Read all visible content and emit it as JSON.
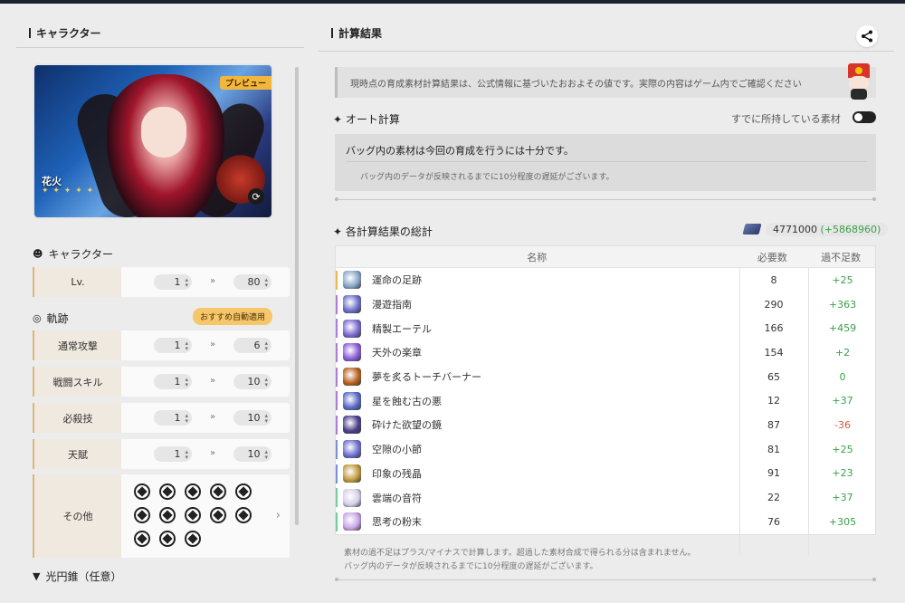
{
  "left": {
    "title": "キャラクター",
    "character": {
      "preview_badge": "プレビュー",
      "name": "花火",
      "stars": "✦ ✦ ✦ ✦ ✦"
    },
    "character_section": "キャラクター",
    "trace_section": "軌跡",
    "auto_apply_button": "おすすめ自動適用",
    "rows": [
      {
        "label": "Lv.",
        "from": "1",
        "to": "80"
      },
      {
        "label": "通常攻撃",
        "from": "1",
        "to": "6"
      },
      {
        "label": "戦闘スキル",
        "from": "1",
        "to": "10"
      },
      {
        "label": "必殺技",
        "from": "1",
        "to": "10"
      },
      {
        "label": "天賦",
        "from": "1",
        "to": "10"
      }
    ],
    "other_label": "その他",
    "light_cone_section": "光円錐（任意）"
  },
  "right": {
    "title": "計算結果",
    "notice": "現時点の育成素材計算結果は、公式情報に基づいたおおよその値です。実際の内容はゲーム内でご確認ください",
    "auto_calc": "オート計算",
    "owned_materials_label": "すでに所持している素材",
    "bag_message": "バッグ内の素材は今回の育成を行うには十分です。",
    "bag_delay": "バッグ内のデータが反映されるまでに10分程度の遅延がございます。",
    "summary_title": "各計算結果の総計",
    "credits": "4771000",
    "credits_surplus": "(+5868960)",
    "table": {
      "headers": [
        "名称",
        "必要数",
        "過不足数"
      ],
      "rows": [
        {
          "name": "運命の足跡",
          "need": "8",
          "diff": "+25",
          "stripe": "#f0b84a",
          "icon": "#8aa7c9"
        },
        {
          "name": "漫遊指南",
          "need": "290",
          "diff": "+363",
          "stripe": "#b07ad8",
          "icon": "#6d6fc9"
        },
        {
          "name": "精製エーテル",
          "need": "166",
          "diff": "+459",
          "stripe": "#b07ad8",
          "icon": "#7a6ad0"
        },
        {
          "name": "天外の楽章",
          "need": "154",
          "diff": "+2",
          "stripe": "#b07ad8",
          "icon": "#8b5ed6"
        },
        {
          "name": "夢を炙るトーチバーナー",
          "need": "65",
          "diff": "0",
          "stripe": "#b07ad8",
          "icon": "#b8621f"
        },
        {
          "name": "星を蝕む古の悪",
          "need": "12",
          "diff": "+37",
          "stripe": "#b07ad8",
          "icon": "#5a6ac8"
        },
        {
          "name": "砕けた欲望の鏡",
          "need": "87",
          "diff": "-36",
          "stripe": "#b07ad8",
          "icon": "#4b3f8a"
        },
        {
          "name": "空隙の小節",
          "need": "81",
          "diff": "+25",
          "stripe": "#7a8fe0",
          "icon": "#6c6fce"
        },
        {
          "name": "印象の残晶",
          "need": "91",
          "diff": "+23",
          "stripe": "#7a8fe0",
          "icon": "#c29b3f"
        },
        {
          "name": "雲端の音符",
          "need": "22",
          "diff": "+37",
          "stripe": "#6fcf9a",
          "icon": "#d6d0ea"
        },
        {
          "name": "思考の粉末",
          "need": "76",
          "diff": "+305",
          "stripe": "#6fcf9a",
          "icon": "#c9a6e6"
        }
      ]
    },
    "footnote1": "素材の過不足はプラス/マイナスで計算します。超過した素材合成で得られる分は含まれません。",
    "footnote2": "バッグ内のデータが反映されるまでに10分程度の遅延がございます。"
  }
}
